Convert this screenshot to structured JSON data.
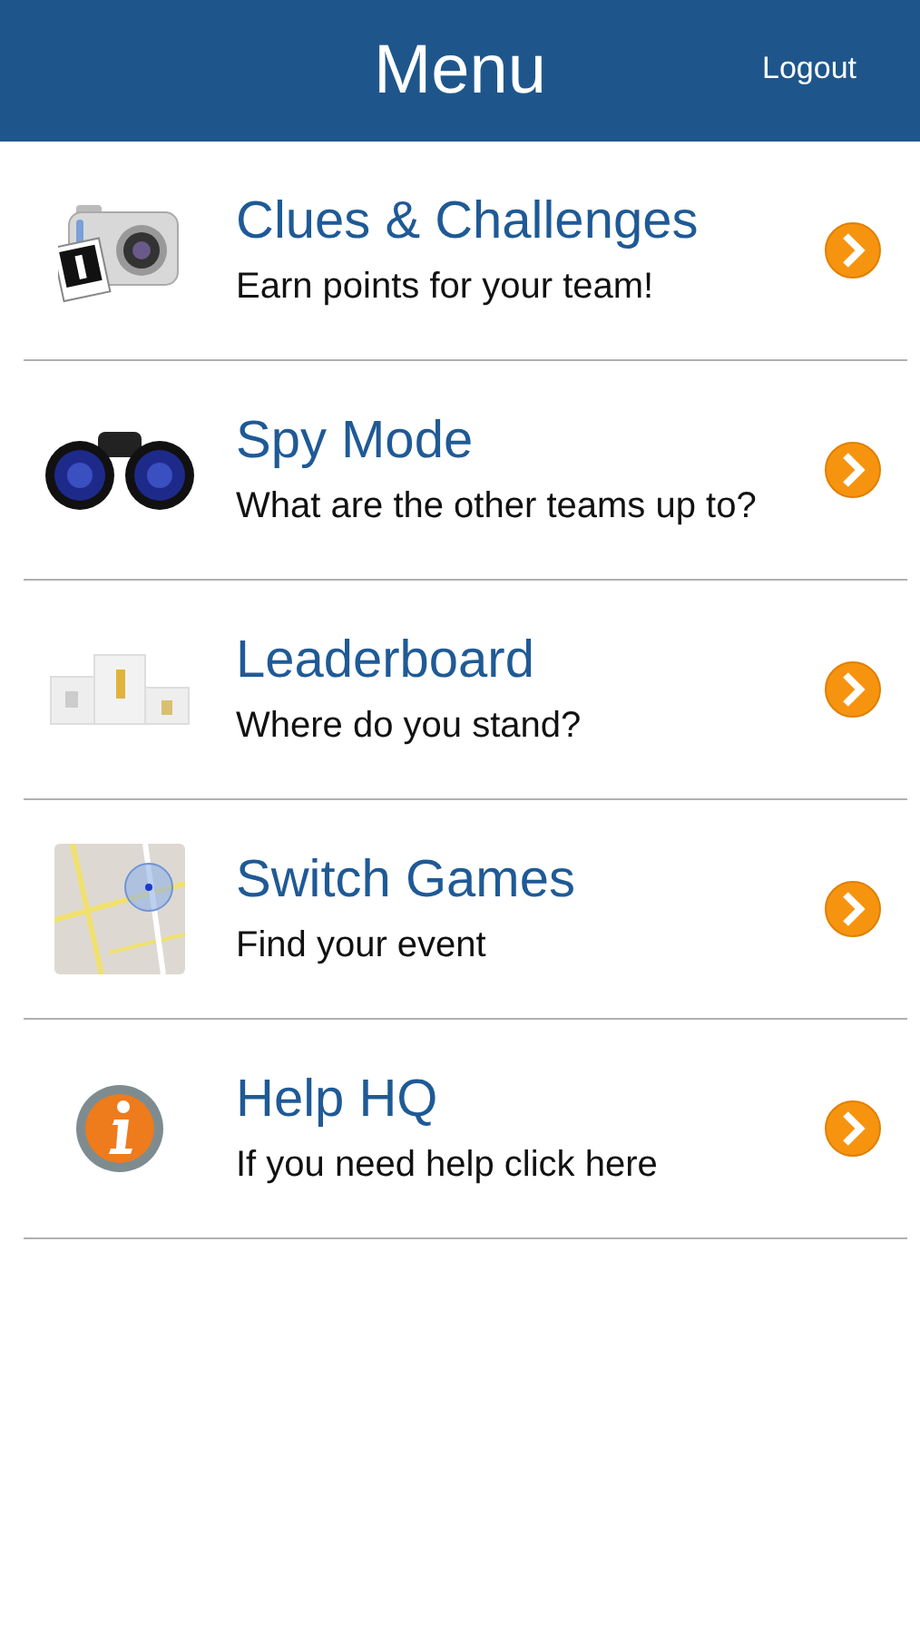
{
  "header": {
    "title": "Menu",
    "logout": "Logout"
  },
  "items": [
    {
      "kind": "camera",
      "title": "Clues & Challenges",
      "subtitle": "Earn points for your team!"
    },
    {
      "kind": "binoculars",
      "title": "Spy Mode",
      "subtitle": "What are the other teams up to?"
    },
    {
      "kind": "podium",
      "title": "Leaderboard",
      "subtitle": "Where do you stand?"
    },
    {
      "kind": "map",
      "title": "Switch Games",
      "subtitle": "Find your event"
    },
    {
      "kind": "info",
      "title": "Help HQ",
      "subtitle": "If you need help click here"
    }
  ]
}
